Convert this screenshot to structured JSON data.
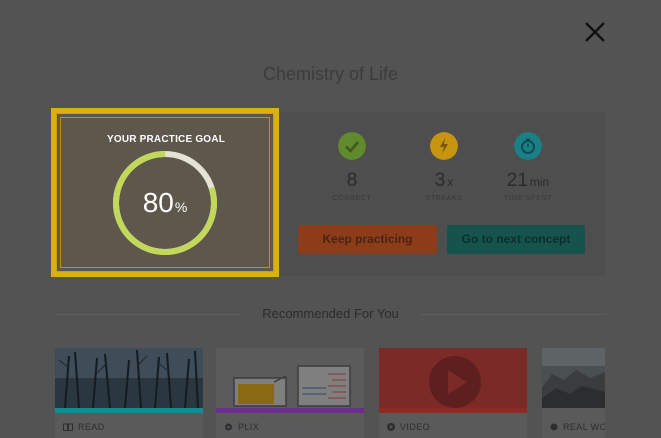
{
  "header": {
    "title": "Chemistry of Life"
  },
  "practice_goal": {
    "heading": "YOUR PRACTICE GOAL",
    "value": "80",
    "unit": "%",
    "progress": 0.8,
    "ring_color": "#c2d85a"
  },
  "stats": [
    {
      "value": "8",
      "unit": "",
      "caption": "CORRECT",
      "icon": "check-icon",
      "color": "#5f8a2e"
    },
    {
      "value": "3",
      "unit": "x",
      "caption": "STREAKS",
      "icon": "lightning-icon",
      "color": "#c6940e"
    },
    {
      "value": "21",
      "unit": "min",
      "caption": "TIME SPENT",
      "icon": "stopwatch-icon",
      "color": "#1a7f86"
    }
  ],
  "actions": {
    "keep_practicing": "Keep practicing",
    "next_concept": "Go to next concept"
  },
  "recommended": {
    "title": "Recommended For You",
    "cards": [
      {
        "type": "READ",
        "icon": "book-icon",
        "bar_color": "#178a96"
      },
      {
        "type": "PLIX",
        "icon": "plix-icon",
        "bar_color": "#6a2f8a"
      },
      {
        "type": "VIDEO",
        "icon": "play-icon",
        "bar_color": "#8e2a26"
      },
      {
        "type": "REAL WOR",
        "icon": "globe-icon",
        "bar_color": "#5a5a5a"
      }
    ]
  }
}
